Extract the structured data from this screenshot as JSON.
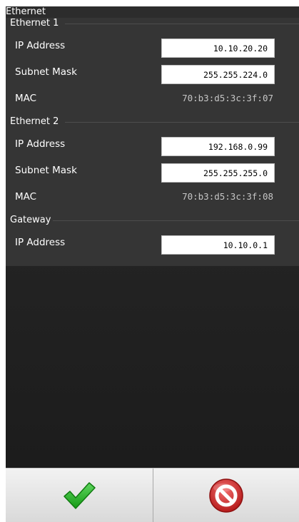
{
  "window": {
    "title": "Ethernet"
  },
  "ethernet1": {
    "title": "Ethernet 1",
    "ip_label": "IP Address",
    "ip_value": "10.10.20.20",
    "subnet_label": "Subnet Mask",
    "subnet_value": "255.255.224.0",
    "mac_label": "MAC",
    "mac_value": "70:b3:d5:3c:3f:07"
  },
  "ethernet2": {
    "title": "Ethernet 2",
    "ip_label": "IP Address",
    "ip_value": "192.168.0.99",
    "subnet_label": "Subnet Mask",
    "subnet_value": "255.255.255.0",
    "mac_label": "MAC",
    "mac_value": "70:b3:d5:3c:3f:08"
  },
  "gateway": {
    "title": "Gateway",
    "ip_label": "IP Address",
    "ip_value": "10.10.0.1"
  },
  "footer": {
    "confirm_icon": "checkmark-icon",
    "cancel_icon": "cancel-icon"
  },
  "colors": {
    "panel_background": "#232323",
    "section_background": "#353535",
    "mac_text": "#c6c6c6",
    "confirm_green": "#2db52d",
    "cancel_red": "#d42a2a"
  }
}
